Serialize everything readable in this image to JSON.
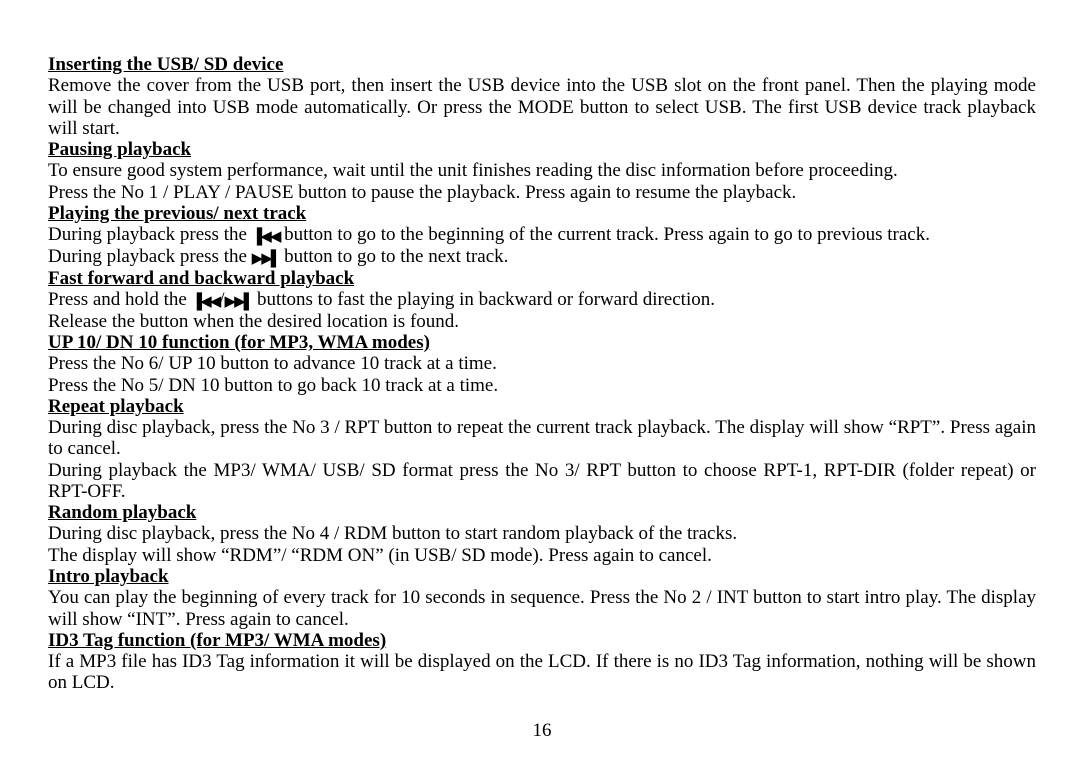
{
  "page_number": "16",
  "sections": {
    "s1": {
      "heading": "Inserting the USB/ SD device",
      "p1a": "Remove the cover from the USB port, then insert the USB device into the USB slot on the front panel. Then the playing mode will be changed into USB mode automatically. Or press the MODE button to select USB. The first USB device track playback will start."
    },
    "s2": {
      "heading": "Pausing playback",
      "p1": "To ensure good system performance, wait until the unit finishes reading the disc information before proceeding.",
      "p2": "Press the No 1 / PLAY / PAUSE button to pause the playback. Press again to resume the playback."
    },
    "s3": {
      "heading": "Playing the previous/ next track",
      "p1_pre": "During playback press the ",
      "p1_post": " button to go to the beginning of the current track. Press again to go to previous track.",
      "p2_pre": "During playback press the ",
      "p2_post": " button to go to the next track."
    },
    "s4": {
      "heading": "Fast forward and backward playback",
      "p1_pre": "Press and hold the ",
      "p1_post": " buttons to fast the playing in backward or forward direction.",
      "p2": "Release the button when the desired location is found."
    },
    "s5": {
      "heading": "UP 10/ DN 10 function (for MP3, WMA modes)",
      "p1": "Press the No 6/ UP 10 button to advance 10 track at a time.",
      "p2": "Press the No 5/ DN 10 button to go back 10 track at a time."
    },
    "s6": {
      "heading": "Repeat playback",
      "p1": "During disc playback, press the No 3 / RPT button to repeat the current track playback. The display will show “RPT”. Press again to cancel.",
      "p2": "During playback the MP3/ WMA/ USB/ SD format press the No 3/ RPT button to choose RPT-1, RPT-DIR (folder repeat) or RPT-OFF."
    },
    "s7": {
      "heading": "Random playback",
      "p1": "During disc playback, press the No 4 / RDM button to start random playback of the tracks.",
      "p2": "The display will show “RDM”/ “RDM ON” (in USB/ SD mode). Press again to cancel."
    },
    "s8": {
      "heading": "Intro playback",
      "p1": "You can play the beginning of every track for 10 seconds in sequence. Press the No 2 / INT button to start intro play. The display will show “INT”. Press again to cancel."
    },
    "s9": {
      "heading": "ID3 Tag function (for MP3/ WMA modes)",
      "p1": "If a MP3 file has ID3 Tag information it will be displayed on the LCD. If there is no ID3 Tag information, nothing will be shown on LCD."
    }
  },
  "icons": {
    "prev": "▐◀◀",
    "next": "▶▶▌",
    "sep": "/"
  }
}
